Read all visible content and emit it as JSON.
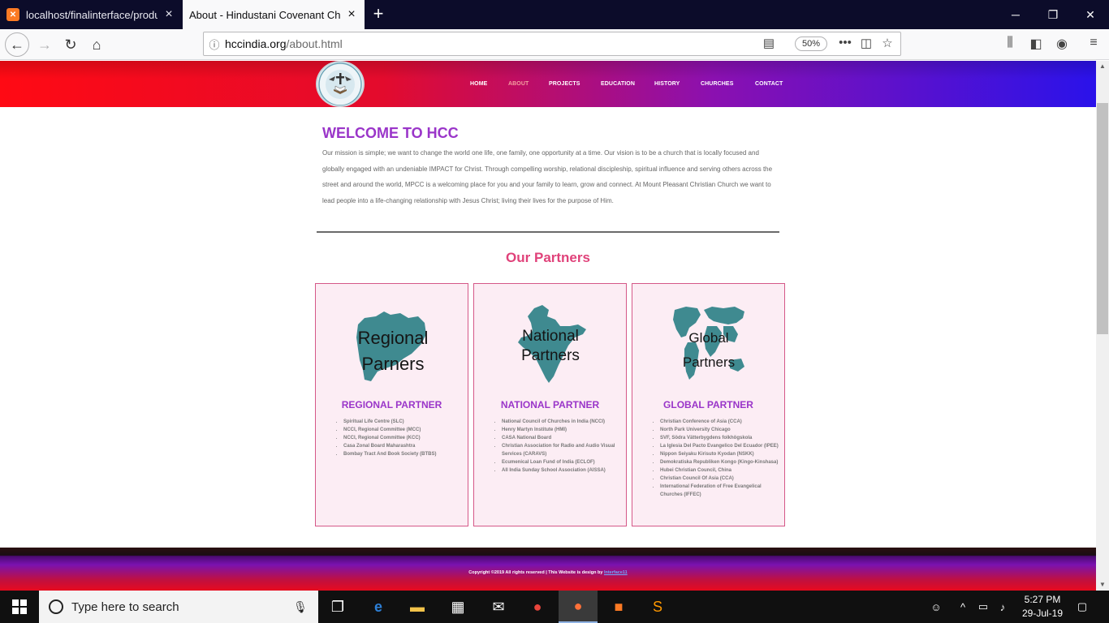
{
  "browser": {
    "tabs": [
      {
        "title": "localhost/finalinterface/produc",
        "favicon": "xampp-icon",
        "active": false
      },
      {
        "title": "About - Hindustani Covenant Chur",
        "active": true
      }
    ],
    "new_tab": "+",
    "url_host": "hccindia.org",
    "url_path": "/about.html",
    "zoom": "50%"
  },
  "site": {
    "menu": [
      "HOME",
      "ABOUT",
      "PROJECTS",
      "EDUCATION",
      "HISTORY",
      "CHURCHES",
      "CONTACT"
    ],
    "active_menu": "ABOUT",
    "welcome_title": "WELCOME TO HCC",
    "welcome_text": "Our mission is simple; we want to change the world one life, one family, one opportunity at a time. Our vision is to be a church that is locally focused and globally engaged with an undeniable IMPACT for Christ. Through compelling worship, relational discipleship, spiritual influence and serving others across the street and around the world, MPCC is a welcoming place for you and your family to learn, grow and connect. At Mount Pleasant Christian Church we want to lead people into a life-changing relationship with Jesus Christ; living their lives for the purpose of Him.",
    "partners_title": "Our Partners",
    "cards": [
      {
        "art_line1": "Regional",
        "art_line2": "Parners",
        "title": "REGIONAL PARTNER",
        "items": [
          "Spiritual Life Centre (SLC)",
          "NCCI, Regional Committee (MCC)",
          "NCCI, Regional Committee (KCC)",
          "Casa Zonal Board Maharashtra",
          "Bombay Tract And Book Society (BTBS)"
        ]
      },
      {
        "art_line1": "National",
        "art_line2": "Partners",
        "title": "NATIONAL PARTNER",
        "items": [
          "National Council of Churches in India (NCCI)",
          "Henry Martyn Institute (HMI)",
          "CASA National Board",
          "Christian Association for Radio and Audio Visual Services (CARAVS)",
          "Ecumenical Loan Fund of India (ECLOF)",
          "All India Sunday School Association (AISSA)"
        ]
      },
      {
        "art_line1": "Global",
        "art_line2": "Partners",
        "title": "GLOBAL PARTNER",
        "items": [
          "Christian Conference of Asia (CCA)",
          "North Park University Chicago",
          "SVF, Södra Vätterbygdens folkhögskola",
          "La Iglesia Del Pacto Evangelico Del Ecuador (IPEE)",
          "Nippon Seiyaku Kirisuto Kyodan (NSKK)",
          "Demokratiska Republiken Kongo (Kingo-Kinshasa)",
          "Hubei Christian Council, China",
          "Christian Council Of Asia (CCA)",
          "International Federation of Free Evangelical Churches (IFFEC)"
        ]
      }
    ],
    "footer_text": "Copyright ©2019 All rights reserved | This Website is design by ",
    "footer_credit": "Interface11"
  },
  "taskbar": {
    "search_placeholder": "Type here to search",
    "time": "5:27 PM",
    "date": "29-Jul-19"
  },
  "colors": {
    "header_gradient_start": "#ff0a14",
    "header_gradient_end": "#2a12ea",
    "title_purple": "#9a35c9",
    "partners_pink": "#e0427a",
    "map_teal": "#3f8a90",
    "card_bg": "#fcedf4"
  }
}
